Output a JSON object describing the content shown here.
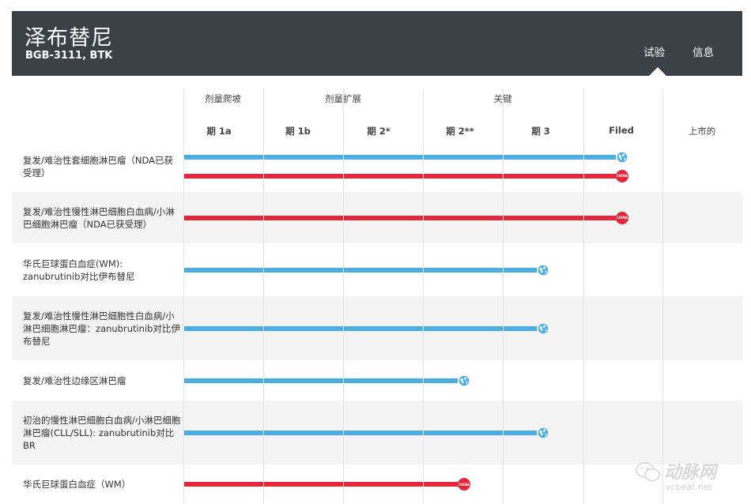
{
  "header": {
    "title": "泽布替尼",
    "subtitle": "BGB-3111, BTK",
    "tabs": [
      {
        "label": "试验",
        "active": true
      },
      {
        "label": "信息",
        "active": false
      }
    ]
  },
  "columns": {
    "stages": [
      "剂量爬坡",
      "剂量扩展",
      "关键"
    ],
    "phases": [
      "期 1a",
      "期 1b",
      "期 2*",
      "期 2**",
      "期 3",
      "Filed",
      "上市的"
    ]
  },
  "legend_colors": {
    "global": "#4aaee0",
    "china": "#e2283a"
  },
  "markers": {
    "globe_icon": "globe-icon",
    "china_badge": "CHINA"
  },
  "rows": [
    {
      "label": "复发/难治性套细胞淋巴瘤（NDA已获受理）",
      "bars": [
        {
          "region": "global",
          "phase_reached": "Filed"
        },
        {
          "region": "china",
          "phase_reached": "Filed"
        }
      ]
    },
    {
      "label": "复发/难治性慢性淋巴细胞白血病/小淋巴细胞淋巴瘤（NDA已获受理）",
      "bars": [
        {
          "region": "china",
          "phase_reached": "Filed"
        }
      ]
    },
    {
      "label": "华氏巨球蛋白血症(WM): zanubrutinib对比伊布替尼",
      "bars": [
        {
          "region": "global",
          "phase_reached": "期 3"
        }
      ]
    },
    {
      "label": "复发/难治性慢性淋巴细胞性白血病/小淋巴细胞淋巴瘤：zanubrutinib对比伊布替尼",
      "bars": [
        {
          "region": "global",
          "phase_reached": "期 3"
        }
      ]
    },
    {
      "label": "复发/难治性边缘区淋巴瘤",
      "bars": [
        {
          "region": "global",
          "phase_reached": "期 2**"
        }
      ]
    },
    {
      "label": "初治的慢性淋巴细胞白血病/小淋巴细胞淋巴瘤(CLL/SLL): zanubrutinib对比BR",
      "bars": [
        {
          "region": "global",
          "phase_reached": "期 3"
        }
      ]
    },
    {
      "label": "华氏巨球蛋白血症（WM）",
      "bars": [
        {
          "region": "china",
          "phase_reached": "期 2**"
        }
      ]
    }
  ],
  "watermark": {
    "name": "动脉网",
    "url": "vcbeat.net"
  }
}
